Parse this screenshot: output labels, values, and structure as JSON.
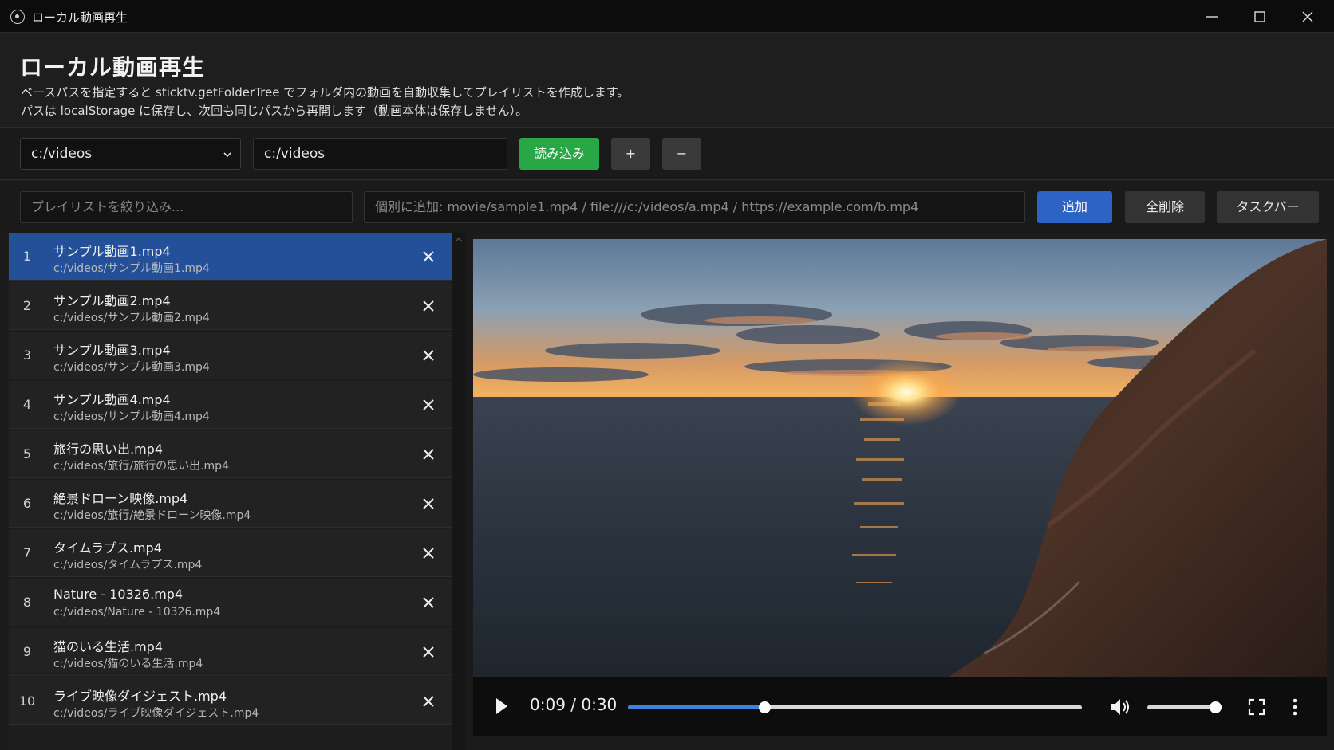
{
  "window": {
    "title": "ローカル動画再生"
  },
  "header": {
    "title": "ローカル動画再生",
    "desc_line1": "ベースパスを指定すると sticktv.getFolderTree でフォルダ内の動画を自動収集してプレイリストを作成します。",
    "desc_line2": "パスは localStorage に保存し、次回も同じパスから再開します（動画本体は保存しません）。"
  },
  "toolbar": {
    "path_select_value": "c:/videos",
    "path_input_value": "c:/videos",
    "load_label": "読み込み",
    "plus_label": "+",
    "minus_label": "−"
  },
  "filterbar": {
    "filter_placeholder": "プレイリストを絞り込み...",
    "add_placeholder": "個別に追加: movie/sample1.mp4 / file:///c:/videos/a.mp4 / https://example.com/b.mp4",
    "add_label": "追加",
    "clear_label": "全削除",
    "taskbar_label": "タスクバー"
  },
  "playlist": [
    {
      "num": "1",
      "name": "サンプル動画1.mp4",
      "path": "c:/videos/サンプル動画1.mp4",
      "active": true
    },
    {
      "num": "2",
      "name": "サンプル動画2.mp4",
      "path": "c:/videos/サンプル動画2.mp4"
    },
    {
      "num": "3",
      "name": "サンプル動画3.mp4",
      "path": "c:/videos/サンプル動画3.mp4"
    },
    {
      "num": "4",
      "name": "サンプル動画4.mp4",
      "path": "c:/videos/サンプル動画4.mp4"
    },
    {
      "num": "5",
      "name": "旅行の思い出.mp4",
      "path": "c:/videos/旅行/旅行の思い出.mp4"
    },
    {
      "num": "6",
      "name": "絶景ドローン映像.mp4",
      "path": "c:/videos/旅行/絶景ドローン映像.mp4"
    },
    {
      "num": "7",
      "name": "タイムラプス.mp4",
      "path": "c:/videos/タイムラプス.mp4"
    },
    {
      "num": "8",
      "name": "Nature - 10326.mp4",
      "path": "c:/videos/Nature - 10326.mp4"
    },
    {
      "num": "9",
      "name": "猫のいる生活.mp4",
      "path": "c:/videos/猫のいる生活.mp4"
    },
    {
      "num": "10",
      "name": "ライブ映像ダイジェスト.mp4",
      "path": "c:/videos/ライブ映像ダイジェスト.mp4"
    }
  ],
  "player": {
    "time": "0:09 / 0:30",
    "progress": 0.3,
    "volume": 0.9,
    "scene": "sunset over the sea with a rocky cliff"
  },
  "icons": {
    "app": "app-icon",
    "minimize": "minimize-icon",
    "maximize": "maximize-icon",
    "close": "close-icon",
    "dropdown": "chevron-down-icon",
    "remove": "close-icon",
    "play": "play-icon",
    "volume": "volume-icon",
    "fullscreen": "fullscreen-icon",
    "more": "more-vertical-icon"
  }
}
